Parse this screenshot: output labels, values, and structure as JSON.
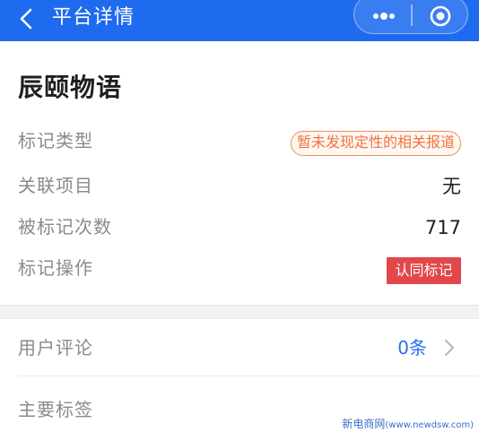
{
  "header": {
    "title": "平台详情",
    "back_icon": "chevron-left-icon",
    "more_icon": "more-dots-icon",
    "close_icon": "target-circle-icon",
    "bg_color": "#1f6bf0"
  },
  "platform": {
    "name": "辰颐物语"
  },
  "details": {
    "tag_type_label": "标记类型",
    "tag_type_value": "暂未发现定性的相关报道",
    "related_project_label": "关联项目",
    "related_project_value": "无",
    "tag_count_label": "被标记次数",
    "tag_count_value": "717",
    "tag_action_label": "标记操作",
    "tag_action_button": "认同标记"
  },
  "comments": {
    "label": "用户评论",
    "count": "0条"
  },
  "tags": {
    "label": "主要标签"
  },
  "watermark": {
    "text": "新电商网",
    "url": "(www.newdsw.com)"
  }
}
